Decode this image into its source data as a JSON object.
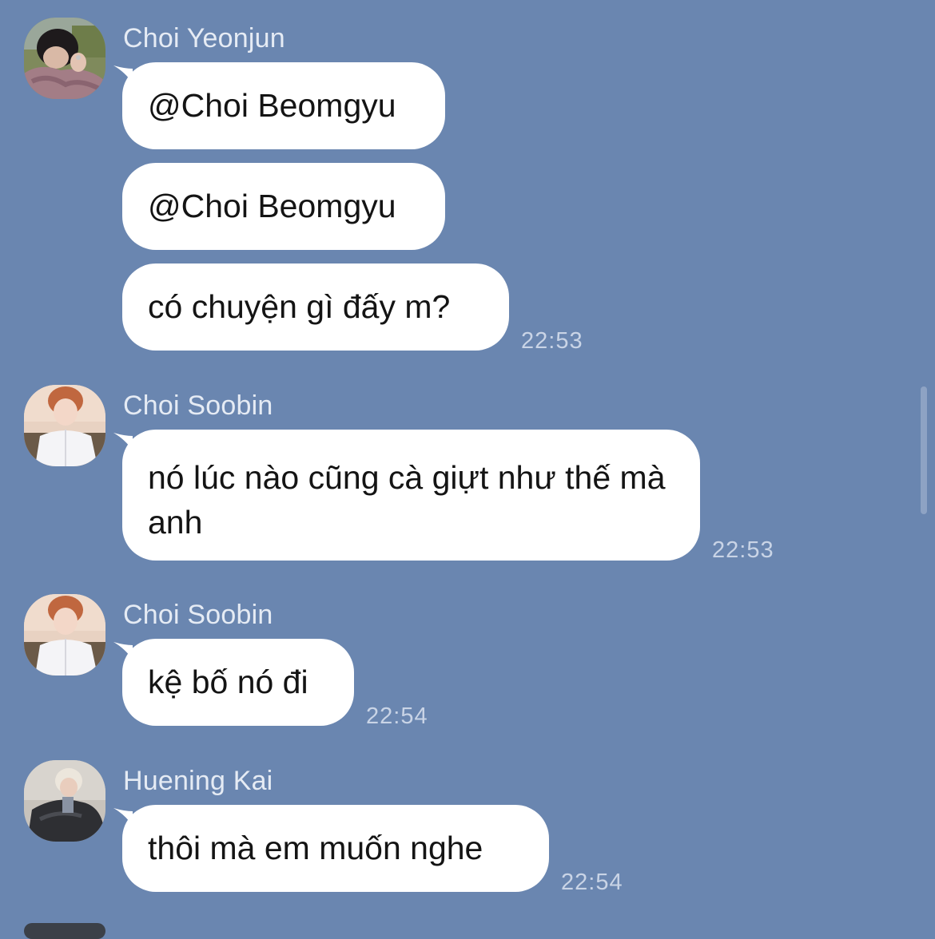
{
  "colors": {
    "background": "#6a86b0",
    "bubble": "#ffffff",
    "name_text": "#e5ebf4",
    "time_text": "#c9d4e6"
  },
  "messages": [
    {
      "sender": "Choi Yeonjun",
      "avatar_icon": "avatar-yeonjun-icon",
      "bubbles": [
        "@Choi Beomgyu",
        "@Choi Beomgyu",
        "có chuyện gì đấy m?"
      ],
      "time": "22:53"
    },
    {
      "sender": "Choi Soobin",
      "avatar_icon": "avatar-soobin-icon",
      "bubbles": [
        "nó lúc nào cũng cà giựt như thế mà anh"
      ],
      "time": "22:53"
    },
    {
      "sender": "Choi Soobin",
      "avatar_icon": "avatar-soobin-icon",
      "bubbles": [
        "kệ bố nó đi"
      ],
      "time": "22:54"
    },
    {
      "sender": "Huening Kai",
      "avatar_icon": "avatar-kai-icon",
      "bubbles": [
        "thôi mà em muốn nghe"
      ],
      "time": "22:54"
    }
  ]
}
